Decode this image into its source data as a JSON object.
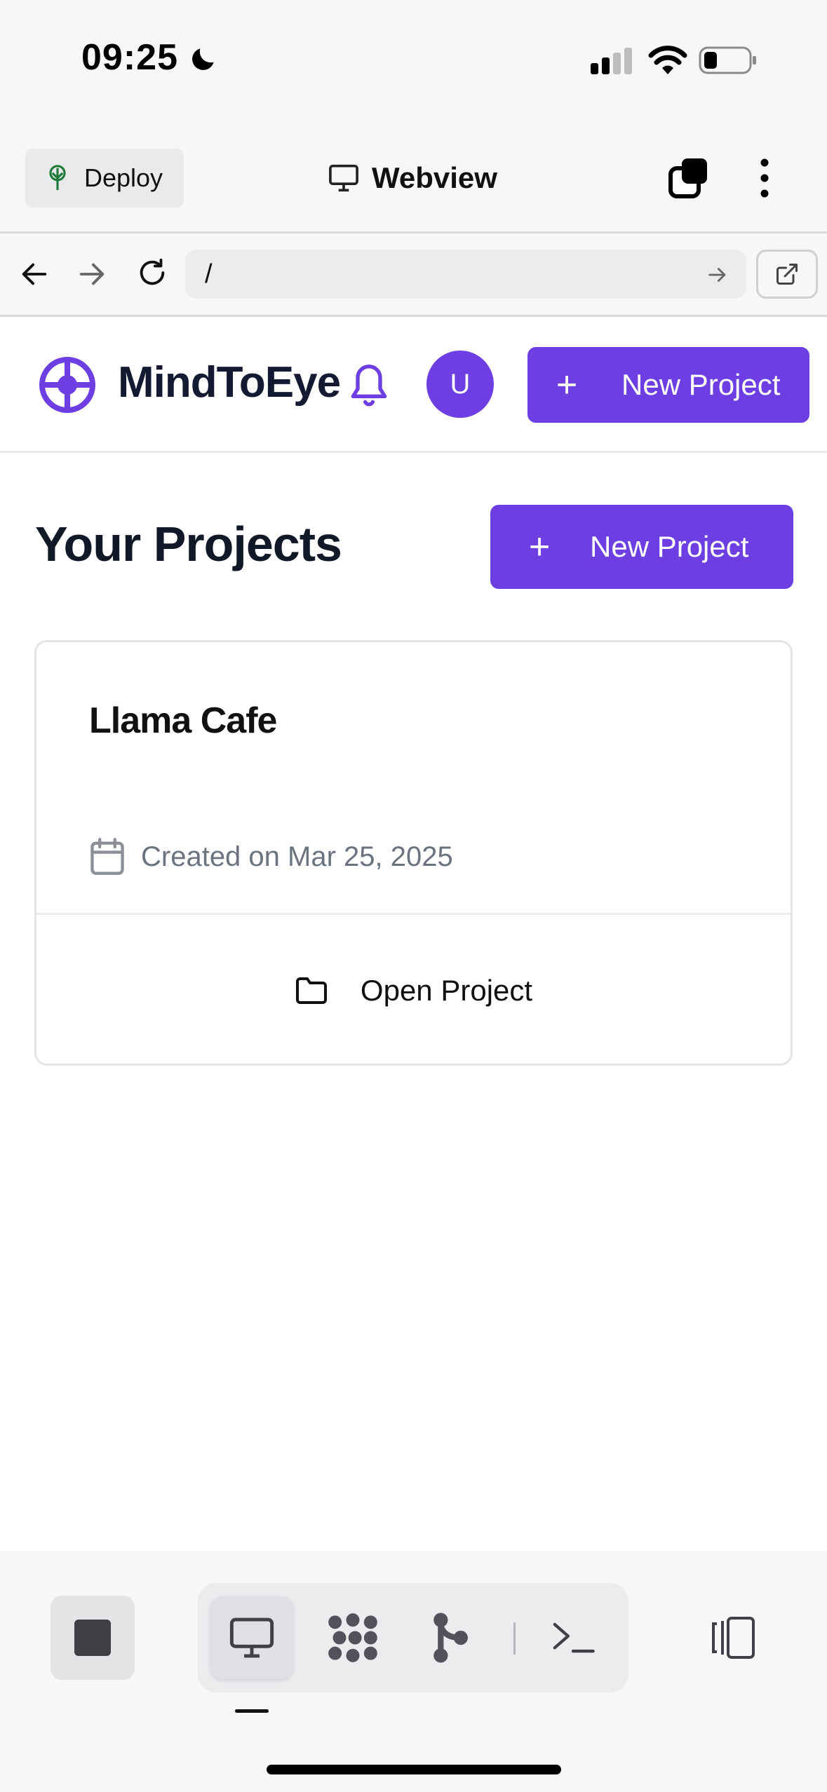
{
  "status_bar": {
    "time": "09:25"
  },
  "app_header": {
    "deploy_label": "Deploy",
    "title": "Webview"
  },
  "url_bar": {
    "value": "/"
  },
  "site": {
    "brand": "MindToEye",
    "avatar_initial": "U",
    "nav_new_project_label": "New Project",
    "accent_color": "#6d3fe3"
  },
  "main": {
    "title": "Your Projects",
    "new_project_label": "New Project",
    "projects": [
      {
        "name": "Llama Cafe",
        "created": "Created on Mar 25, 2025",
        "open_label": "Open Project"
      }
    ]
  },
  "toolbar": {
    "icons": [
      "stop-icon",
      "webview-icon",
      "packages-icon",
      "git-icon",
      "terminal-icon",
      "panels-icon"
    ]
  }
}
